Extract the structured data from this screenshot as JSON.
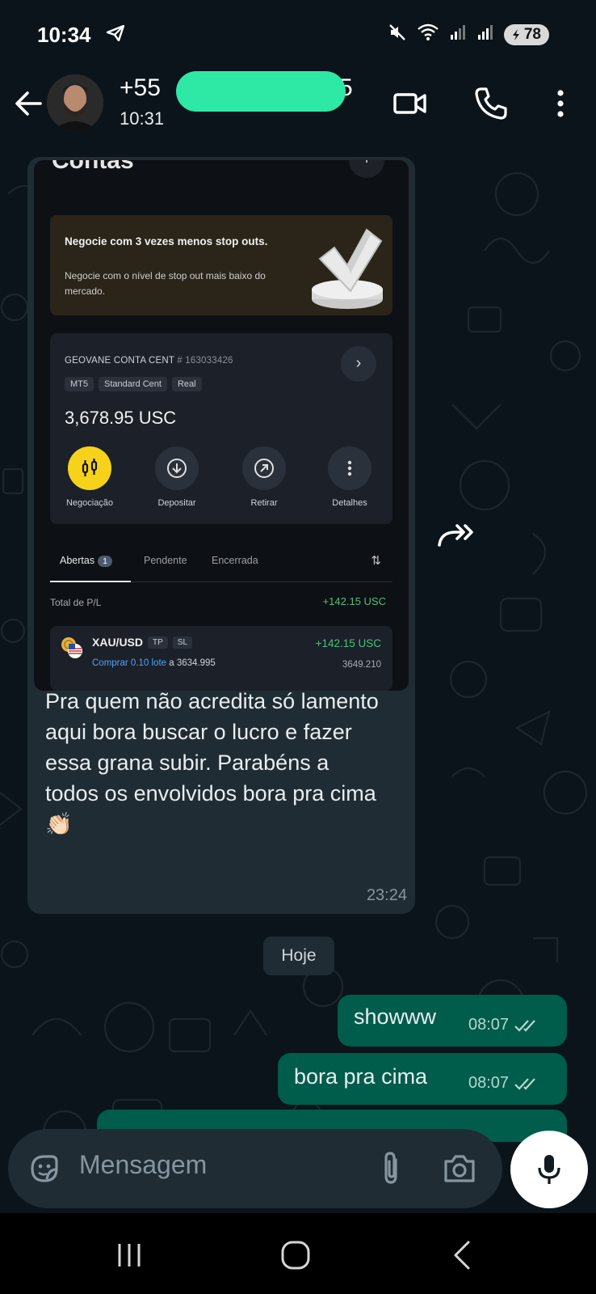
{
  "status_bar": {
    "time": "10:34",
    "battery": "78",
    "icons": [
      "telegram-icon",
      "mute-icon",
      "wifi-icon",
      "signal-icon",
      "signal-icon",
      "battery-icon"
    ]
  },
  "header": {
    "contact_prefix": "+55",
    "contact_suffix": "5",
    "last_seen": "10:31",
    "icons": [
      "back-arrow-icon",
      "video-call-icon",
      "phone-icon",
      "more-vert-icon"
    ]
  },
  "incoming_message": {
    "screenshot": {
      "page_title": "Contas",
      "promo_title": "Negocie com 3 vezes menos stop outs.",
      "promo_text": "Negocie com o nível de stop out mais baixo do mercado.",
      "account_name": "GEOVANE CONTA CENT",
      "account_number": "# 163033426",
      "tags": [
        "MT5",
        "Standard Cent",
        "Real"
      ],
      "balance": "3,678.95 USC",
      "actions": [
        "Negociação",
        "Depositar",
        "Retirar",
        "Detalhes"
      ],
      "tabs": [
        "Abertas",
        "Pendente",
        "Encerrada"
      ],
      "open_count": "1",
      "total_pl_label": "Total de P/L",
      "total_pl_value": "+142.15 USC",
      "position": {
        "symbol": "XAU/USD",
        "tag_tp": "TP",
        "tag_sl": "SL",
        "side": "Comprar 0.10 lote",
        "open_price": "a 3634.995",
        "pnl": "+142.15 USC",
        "current_price": "3649.210"
      }
    },
    "text": "Pra quem não acredita só lamento aqui bora buscar o lucro e fazer essa grana subir. Parabéns a todos os envolvidos bora pra cima 👏🏻",
    "time": "23:24"
  },
  "day_divider": "Hoje",
  "outgoing_messages": [
    {
      "text": "showww",
      "time": "08:07"
    },
    {
      "text": "bora pra cima",
      "time": "08:07"
    }
  ],
  "composer": {
    "placeholder": "Mensagem",
    "icons": [
      "sticker-icon",
      "attach-icon",
      "camera-icon",
      "mic-icon"
    ]
  },
  "nav": {
    "icons": [
      "recents-icon",
      "home-icon",
      "back-icon"
    ]
  },
  "colors": {
    "background": "#0b141a",
    "incoming_bubble": "#1f2c34",
    "outgoing_bubble": "#005c4b",
    "profit_green": "#4cc27a",
    "redaction": "#2ee8a5",
    "negociacao_yellow": "#f7d21a"
  }
}
